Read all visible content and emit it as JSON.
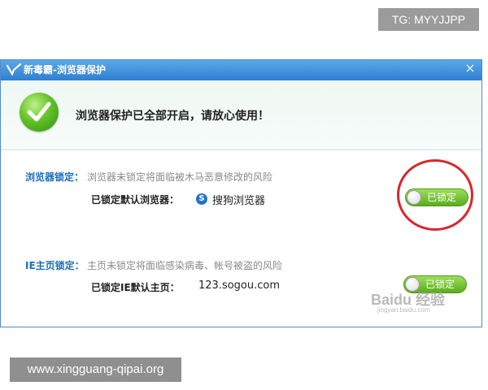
{
  "watermarks": {
    "top": "TG: MYYJJPP",
    "bottom": "www.xingguang-qipai.org",
    "baidu_logo": "Baidu 经验",
    "baidu_url": "jingyan.baidu.com"
  },
  "window": {
    "title": "新毒霸-浏览器保护",
    "close_glyph": "×",
    "header_message": "浏览器保护已全部开启，请放心使用！",
    "logo_icon": "jinshan-duba-logo-icon",
    "status_icon": "check-icon"
  },
  "sections": {
    "browser": {
      "title": "浏览器锁定：",
      "description": "浏览器未锁定将面临被木马恶意修改的风险",
      "label": "已锁定默认浏览器：",
      "value": "搜狗浏览器",
      "value_icon": "sogou-browser-icon",
      "value_icon_glyph": "S",
      "toggle_label": "已锁定"
    },
    "homepage": {
      "title": "IE主页锁定：",
      "description": "主页未锁定将面临感染病毒、帐号被盗的风险",
      "label": "已锁定IE默认主页：",
      "value": "123.sogou.com",
      "toggle_label": "已锁定"
    }
  },
  "colors": {
    "accent_blue": "#1c6fb5",
    "toggle_green": "#58ad1f",
    "highlight_red": "#d9262c"
  }
}
